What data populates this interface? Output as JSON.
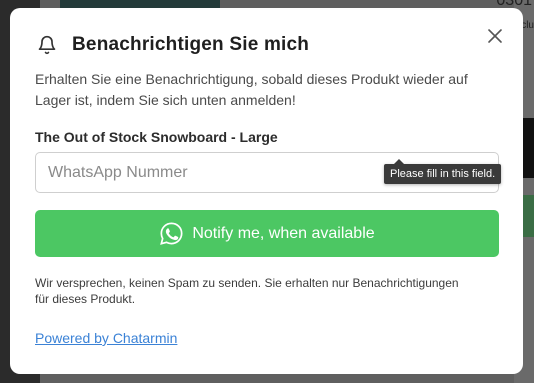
{
  "background": {
    "top_right_text": "0301",
    "right_fragment": "clu"
  },
  "modal": {
    "title": "Benachrichtigen Sie mich",
    "bell_icon": "bell-icon",
    "close_icon": "close-icon",
    "description": "Erhalten Sie eine Benachrichtigung, sobald dieses Produkt wieder auf Lager ist, indem Sie sich unten anmelden!",
    "product_name": "The Out of Stock Snowboard - Large",
    "whatsapp_field": {
      "value": "",
      "placeholder": "WhatsApp Nummer"
    },
    "validation_tooltip": "Please fill in this field.",
    "notify_button": {
      "label": "Notify me, when available",
      "icon": "whatsapp-icon",
      "color": "#4cc763"
    },
    "disclaimer": "Wir versprechen, keinen Spam zu senden. Sie erhalten nur Benachrichtigungen für dieses Produkt.",
    "powered_by": "Powered by Chatarmin",
    "link_color": "#3b82d6"
  }
}
